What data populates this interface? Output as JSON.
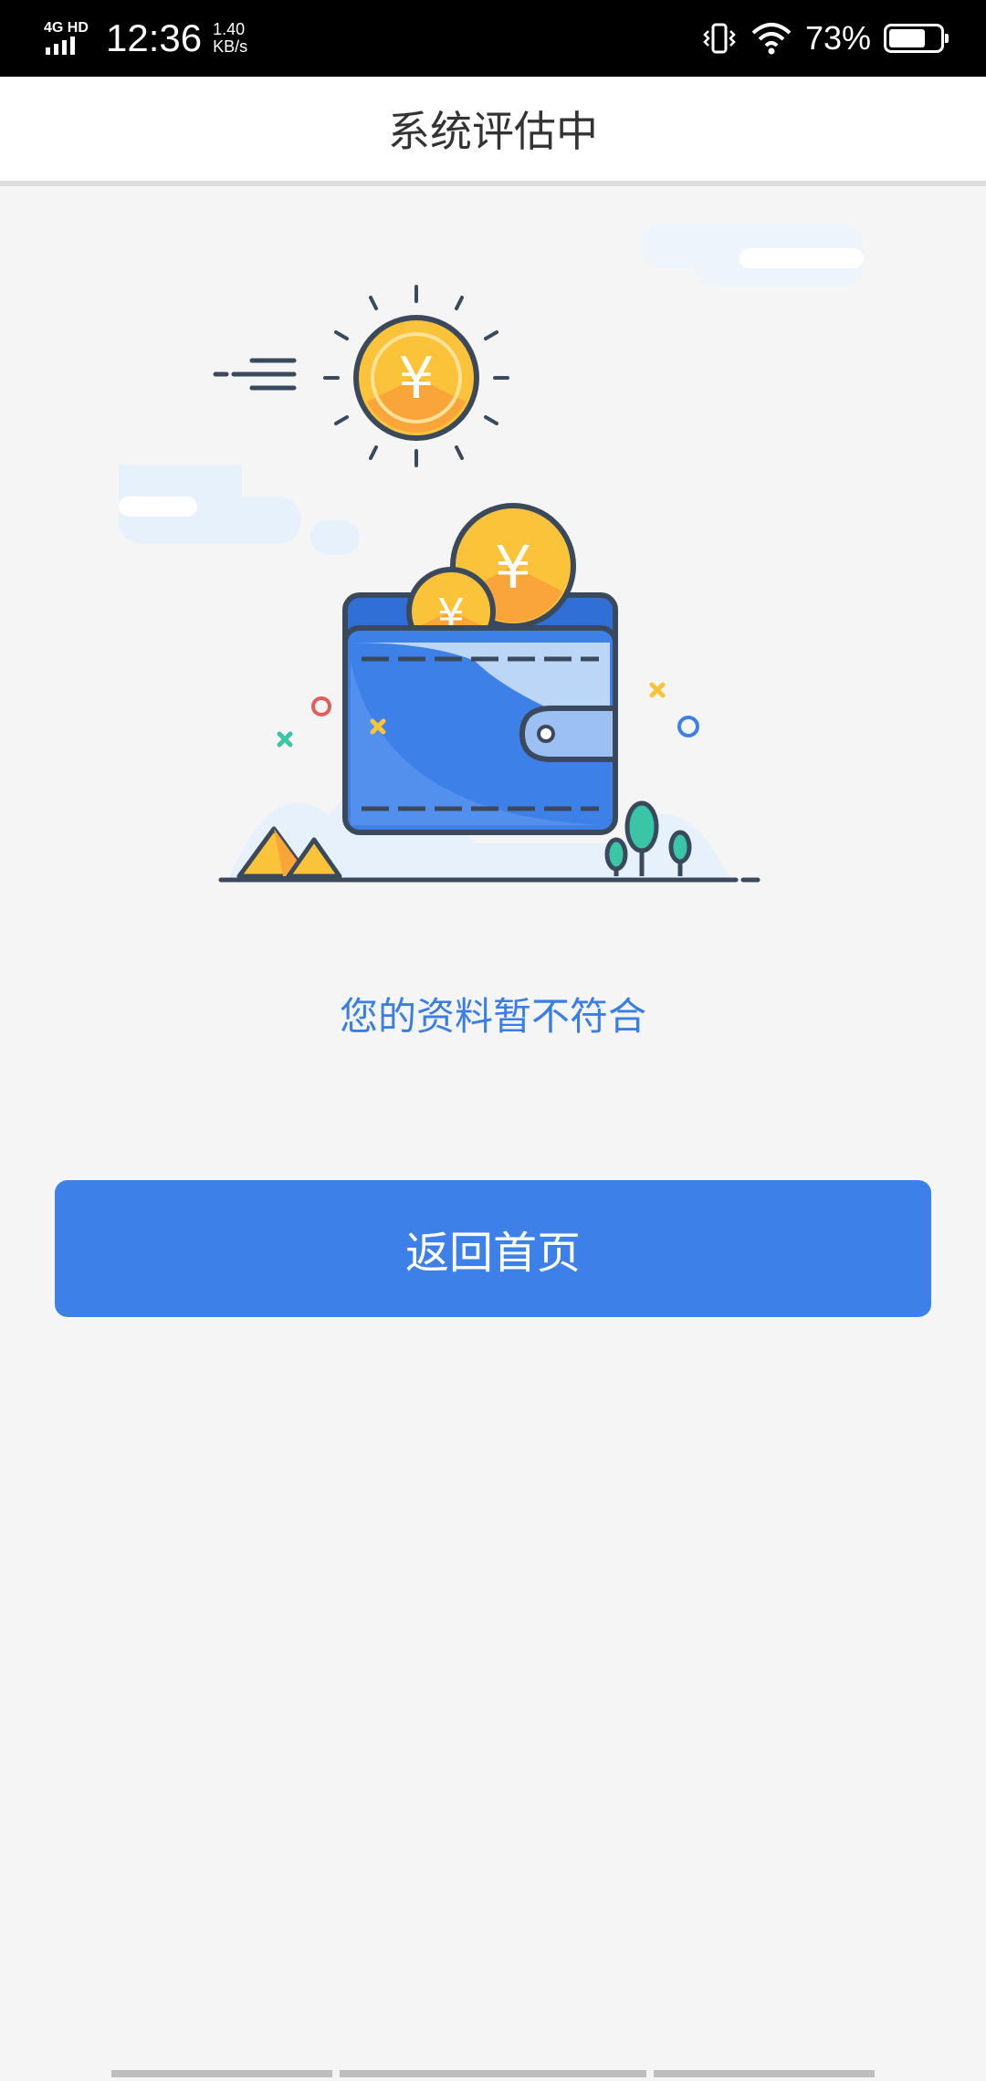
{
  "status_bar": {
    "network": "4G HD",
    "time": "12:36",
    "speed_value": "1.40",
    "speed_unit": "KB/s",
    "battery_percent": "73%",
    "battery_level": 0.73
  },
  "header": {
    "title": "系统评估中"
  },
  "illustration": {
    "description_icons": [
      "sun-coin-icon",
      "wallet-icon",
      "coin-icon",
      "cloud-icon",
      "tree-icon",
      "mountain-icon"
    ]
  },
  "main": {
    "message": "您的资料暂不符合",
    "home_button_label": "返回首页"
  },
  "colors": {
    "primary": "#3d80e8",
    "message_text": "#3a7ee4",
    "background": "#f5f5f5",
    "coin_yellow": "#fbc33a",
    "wallet_blue": "#3d80e8"
  }
}
